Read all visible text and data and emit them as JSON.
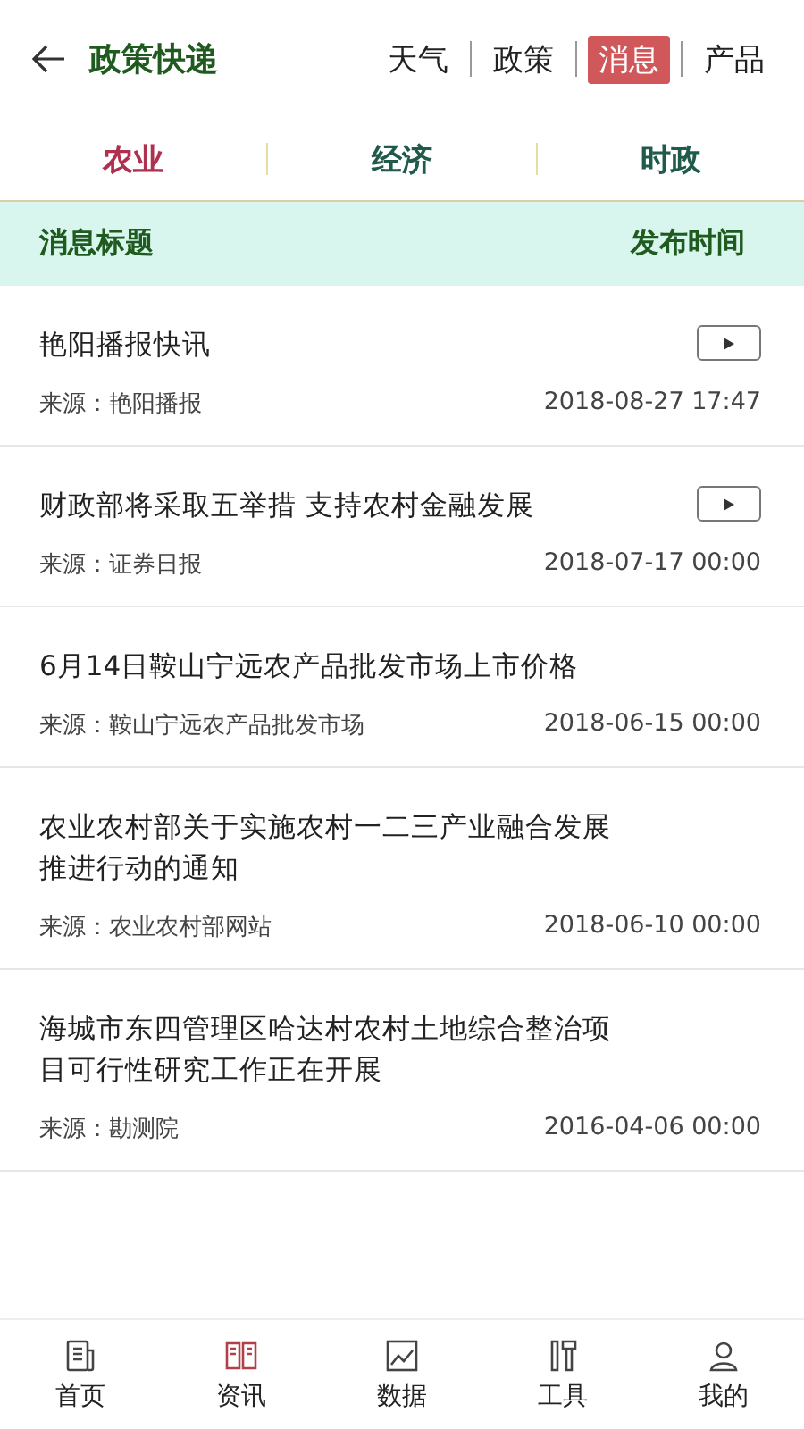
{
  "header": {
    "title": "政策快递",
    "tabs": [
      {
        "label": "天气",
        "selected": false
      },
      {
        "label": "政策",
        "selected": false
      },
      {
        "label": "消息",
        "selected": true
      },
      {
        "label": "产品",
        "selected": false
      }
    ]
  },
  "categories": [
    {
      "label": "农业",
      "selected": true
    },
    {
      "label": "经济",
      "selected": false
    },
    {
      "label": "时政",
      "selected": false
    }
  ],
  "table": {
    "columns": [
      "消息标题",
      "发布时间"
    ],
    "rows": [
      {
        "title": "艳阳播报快讯",
        "source": "来源：艳阳播报",
        "time": "2018-08-27 17:47",
        "video": true
      },
      {
        "title": "财政部将采取五举措 支持农村金融发展",
        "source": "来源：证券日报",
        "time": "2018-07-17 00:00",
        "video": true
      },
      {
        "title": "6月14日鞍山宁远农产品批发市场上市价格",
        "source": "来源：鞍山宁远农产品批发市场",
        "time": "2018-06-15 00:00",
        "video": false
      },
      {
        "title": "农业农村部关于实施农村一二三产业融合发展推进行动的通知",
        "source": "来源：农业农村部网站",
        "time": "2018-06-10 00:00",
        "video": false
      },
      {
        "title": "海城市东四管理区哈达村农村土地综合整治项目可行性研究工作正在开展",
        "source": "来源：勘测院",
        "time": "2016-04-06 00:00",
        "video": false
      }
    ]
  },
  "nav": [
    {
      "label": "首页",
      "kind": "home",
      "selected": false
    },
    {
      "label": "资讯",
      "kind": "book",
      "selected": true
    },
    {
      "label": "数据",
      "kind": "chart",
      "selected": false
    },
    {
      "label": "工具",
      "kind": "tools",
      "selected": false
    },
    {
      "label": "我的",
      "kind": "user",
      "selected": false
    }
  ]
}
